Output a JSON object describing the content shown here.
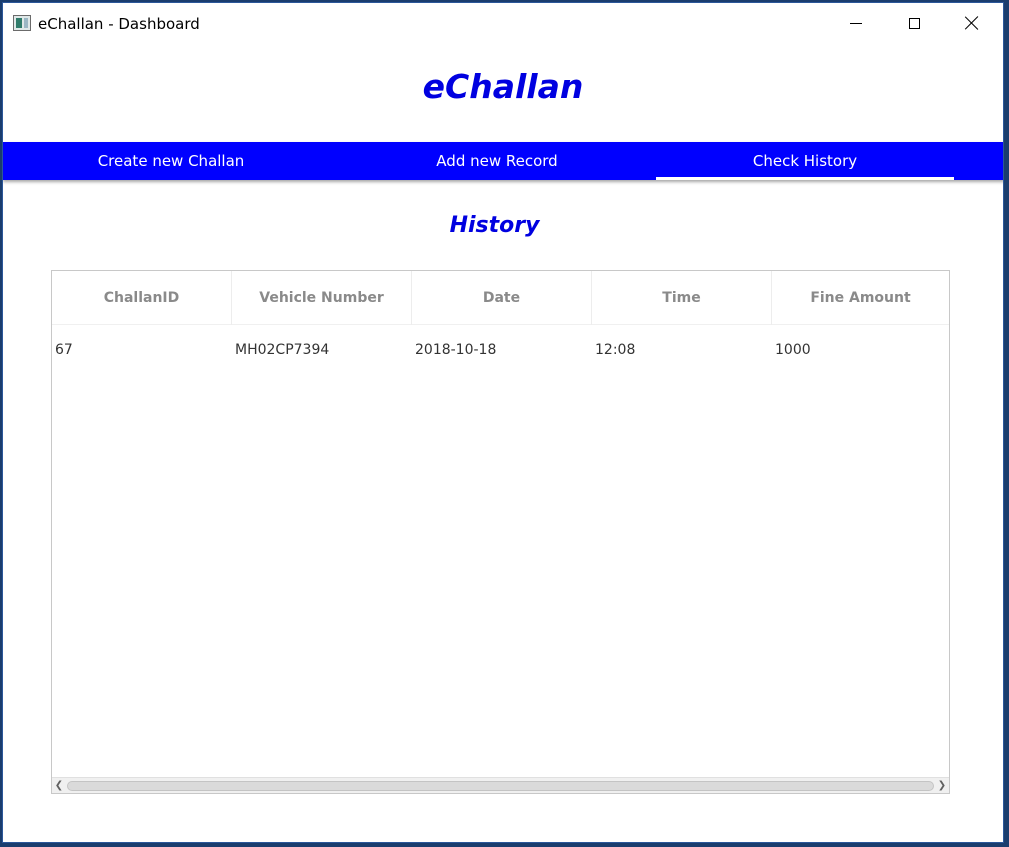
{
  "window": {
    "title": "eChallan - Dashboard"
  },
  "app": {
    "title": "eChallan"
  },
  "nav": {
    "tabs": [
      {
        "label": "Create new Challan",
        "active": false
      },
      {
        "label": "Add new Record",
        "active": false
      },
      {
        "label": "Check History",
        "active": true
      }
    ]
  },
  "section": {
    "title": "History"
  },
  "table": {
    "columns": [
      "ChallanID",
      "Vehicle Number",
      "Date",
      "Time",
      "Fine Amount"
    ],
    "rows": [
      [
        "67",
        "MH02CP7394",
        "2018-10-18",
        "12:08",
        "1000"
      ]
    ]
  },
  "colors": {
    "accent": "#0000ff",
    "title": "#0000e0"
  },
  "icons": {
    "app": "app-icon",
    "minimize": "minimize-icon",
    "maximize": "maximize-icon",
    "close": "close-icon",
    "scroll_left": "chevron-left-icon",
    "scroll_right": "chevron-right-icon"
  }
}
